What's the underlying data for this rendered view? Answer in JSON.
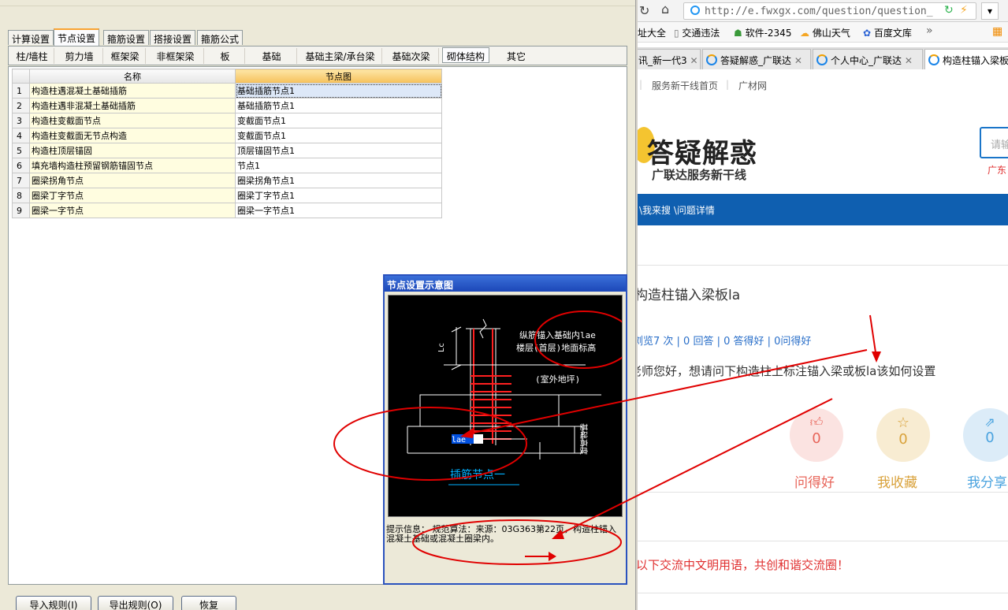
{
  "app": {
    "top_tabs": [
      "计算设置",
      "节点设置",
      "箍筋设置",
      "搭接设置",
      "箍筋公式"
    ],
    "sub_tabs": [
      "柱/墙柱",
      "剪力墙",
      "框架梁",
      "非框架梁",
      "板",
      "基础",
      "基础主梁/承台梁",
      "基础次梁",
      "砌体结构",
      "其它"
    ],
    "table": {
      "headers": [
        "名称",
        "节点图"
      ],
      "rows": [
        {
          "no": "1",
          "name": "构造柱遇混凝土基础插筋",
          "node": "基础插筋节点1"
        },
        {
          "no": "2",
          "name": "构造柱遇非混凝土基础插筋",
          "node": "基础插筋节点1"
        },
        {
          "no": "3",
          "name": "构造柱变截面节点",
          "node": "变截面节点1"
        },
        {
          "no": "4",
          "name": "构造柱变截面无节点构造",
          "node": "变截面节点1"
        },
        {
          "no": "5",
          "name": "构造柱顶层锚固",
          "node": "顶层锚固节点1"
        },
        {
          "no": "6",
          "name": "填充墙构造柱预留钢筋锚固节点",
          "node": "节点1"
        },
        {
          "no": "7",
          "name": "圈梁拐角节点",
          "node": "圈梁拐角节点1"
        },
        {
          "no": "8",
          "name": "圈梁丁字节点",
          "node": "圈梁丁字节点1"
        },
        {
          "no": "9",
          "name": "圈梁一字节点",
          "node": "圈梁一字节点1"
        }
      ]
    },
    "buttons": {
      "import": "导入规则(I)",
      "export": "导出规则(O)",
      "restore": "恢复"
    }
  },
  "popup": {
    "title": "节点设置示意图",
    "diagram": {
      "note1": "纵筋锚入基础内lae",
      "note2": "楼层(首层)地面标高",
      "note3": "(室外地坪)",
      "lc": "Lc",
      "lae": "lae",
      "hj": "基础高度",
      "label": "插筋节点一"
    },
    "tip": "提示信息： 规范算法：来源：03G363第22页，构造柱锚入混凝土基础或混凝土圈梁内。"
  },
  "browser": {
    "url": "http://e.fwxgx.com/question/question_",
    "bookmarks": [
      "址大全",
      "交通违法",
      "软件-2345",
      "佛山天气",
      "百度文库"
    ],
    "tabs": [
      "讯_新一代3",
      "答疑解惑_广联达",
      "个人中心_广联达",
      "构造柱锚入梁板"
    ],
    "subnav": [
      "服务新干线首页",
      "广材网"
    ],
    "logo_title": "答疑解惑",
    "logo_sub": "广联达服务新干线",
    "search_placeholder": "请输",
    "region": "广东",
    "breadcrumb": "\\我来搜 \\问题详情",
    "question_title": "构造柱锚入梁板la",
    "stats": "浏览7 次 | 0 回答 | 0 答得好 | 0问得好",
    "question_body": "老师您好，想请问下构造柱上标注锚入梁或板la该如何设置",
    "actions": [
      {
        "count": "0",
        "label": "问得好",
        "color": "#e8655a"
      },
      {
        "count": "0",
        "label": "我收藏",
        "color": "#d9a23b"
      },
      {
        "count": "0",
        "label": "我分享",
        "color": "#4aa3df"
      }
    ],
    "notice": "以下交流中文明用语，共创和谐交流圈！"
  }
}
